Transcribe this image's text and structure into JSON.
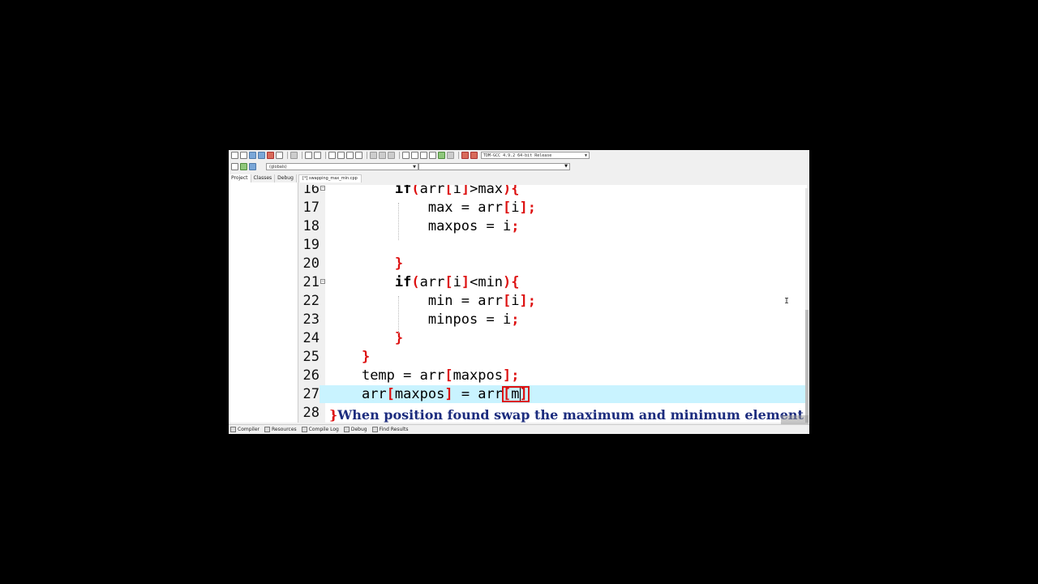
{
  "toolbar": {
    "compiler_select": "TDM-GCC 4.9.2 64-bit Release",
    "scope_select": "(globals)"
  },
  "side_tabs": [
    "Project",
    "Classes",
    "Debug"
  ],
  "file_tab": "[*] swapping_max_min.cpp",
  "code_lines": [
    {
      "n": "16",
      "fold": true,
      "indent": "    ",
      "tokens": [
        [
          "kw",
          "if"
        ],
        [
          "sym",
          "("
        ],
        [
          "id",
          "arr"
        ],
        [
          "sym",
          "["
        ],
        [
          "id",
          "i"
        ],
        [
          "sym",
          "]"
        ],
        [
          "id",
          ">max"
        ],
        [
          "sym",
          "){"
        ]
      ]
    },
    {
      "n": "17",
      "fold": false,
      "indent": "      ",
      "tokens": [
        [
          "id",
          "max = arr"
        ],
        [
          "sym",
          "["
        ],
        [
          "id",
          "i"
        ],
        [
          "sym",
          "];"
        ]
      ]
    },
    {
      "n": "18",
      "fold": false,
      "indent": "      ",
      "tokens": [
        [
          "id",
          "maxpos = i"
        ],
        [
          "sym",
          ";"
        ]
      ]
    },
    {
      "n": "19",
      "fold": false,
      "indent": "",
      "tokens": []
    },
    {
      "n": "20",
      "fold": false,
      "indent": "    ",
      "tokens": [
        [
          "sym",
          "}"
        ]
      ]
    },
    {
      "n": "21",
      "fold": true,
      "indent": "    ",
      "tokens": [
        [
          "kw",
          "if"
        ],
        [
          "sym",
          "("
        ],
        [
          "id",
          "arr"
        ],
        [
          "sym",
          "["
        ],
        [
          "id",
          "i"
        ],
        [
          "sym",
          "]"
        ],
        [
          "id",
          "<min"
        ],
        [
          "sym",
          "){"
        ]
      ]
    },
    {
      "n": "22",
      "fold": false,
      "indent": "      ",
      "tokens": [
        [
          "id",
          "min = arr"
        ],
        [
          "sym",
          "["
        ],
        [
          "id",
          "i"
        ],
        [
          "sym",
          "];"
        ]
      ]
    },
    {
      "n": "23",
      "fold": false,
      "indent": "      ",
      "tokens": [
        [
          "id",
          "minpos = i"
        ],
        [
          "sym",
          ";"
        ]
      ]
    },
    {
      "n": "24",
      "fold": false,
      "indent": "    ",
      "tokens": [
        [
          "sym",
          "}"
        ]
      ]
    },
    {
      "n": "25",
      "fold": false,
      "indent": "  ",
      "tokens": [
        [
          "sym",
          "}"
        ]
      ]
    },
    {
      "n": "26",
      "fold": false,
      "indent": "  ",
      "tokens": [
        [
          "id",
          "temp = arr"
        ],
        [
          "sym",
          "["
        ],
        [
          "id",
          "maxpos"
        ],
        [
          "sym",
          "];"
        ]
      ]
    },
    {
      "n": "27",
      "fold": false,
      "indent": "  ",
      "current": true,
      "tokens": [
        [
          "id",
          "arr"
        ],
        [
          "sym",
          "["
        ],
        [
          "id",
          "maxpos"
        ],
        [
          "sym",
          "]"
        ],
        [
          "id",
          " = arr"
        ],
        [
          "sym",
          "["
        ],
        [
          "id",
          "m"
        ],
        [
          "sym",
          "]"
        ]
      ]
    },
    {
      "n": "28",
      "fold": false,
      "indent": "",
      "tokens": []
    }
  ],
  "caption": {
    "brace": "}",
    "text": "When position found swap the maximum and minimum element"
  },
  "status_tabs": [
    "Compiler",
    "Resources",
    "Compile Log",
    "Debug",
    "Find Results"
  ],
  "colors": {
    "keyword": "#000000",
    "symbol": "#dd1111",
    "current_line": "#c9f3ff",
    "caption": "#1c2c7e"
  }
}
